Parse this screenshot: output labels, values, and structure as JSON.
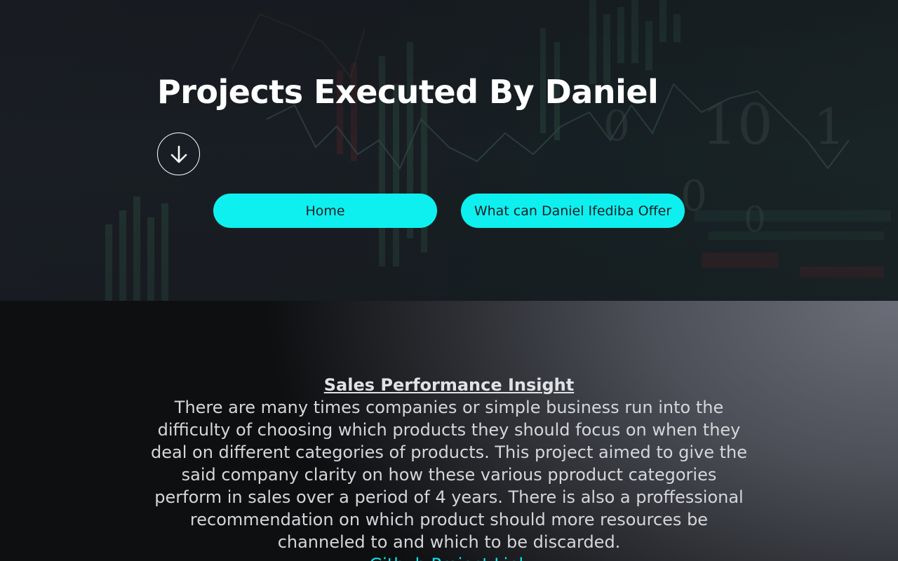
{
  "hero": {
    "title": "Projects Executed By Daniel",
    "scroll_icon": "arrow-down-icon",
    "nav": [
      {
        "label": "Home"
      },
      {
        "label": "What can Daniel Ifediba Offer"
      }
    ]
  },
  "project": {
    "title": "Sales Performance Insight",
    "description": "There are many times companies or simple business run into the difficulty of choosing which products they should focus on when they deal on different categories of products. This project aimed to give the said company clarity on how these various pproduct categories perform in sales over a period of 4 years. There is also a proffessional recommendation on which product should more resources be channeled to and which to be discarded.",
    "link_label": "Github Project Link"
  },
  "colors": {
    "accent": "#0ef0ef",
    "title_text": "#ffffff",
    "link": "#0ee4ea"
  }
}
